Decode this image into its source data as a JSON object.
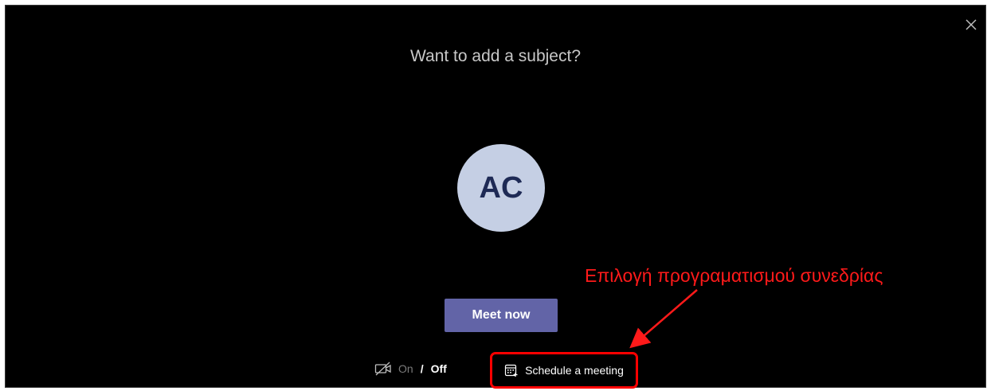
{
  "dialog": {
    "subject_prompt": "Want to add a subject?",
    "avatar_initials": "AC",
    "meet_now_label": "Meet now",
    "video": {
      "on_label": "On",
      "separator": "/",
      "off_label": "Off",
      "state": "off"
    },
    "schedule_label": "Schedule a meeting"
  },
  "annotation": {
    "text": "Επιλογή προγραματισμού συνεδρίας",
    "color": "#ff1a1a"
  },
  "colors": {
    "background": "#000000",
    "accent": "#6264a7",
    "avatar_bg": "#c5cfe4",
    "avatar_text": "#1e2a55",
    "highlight": "#ff0000"
  },
  "icons": {
    "close": "close-icon",
    "video_off": "video-off-icon",
    "calendar": "calendar-add-icon"
  }
}
